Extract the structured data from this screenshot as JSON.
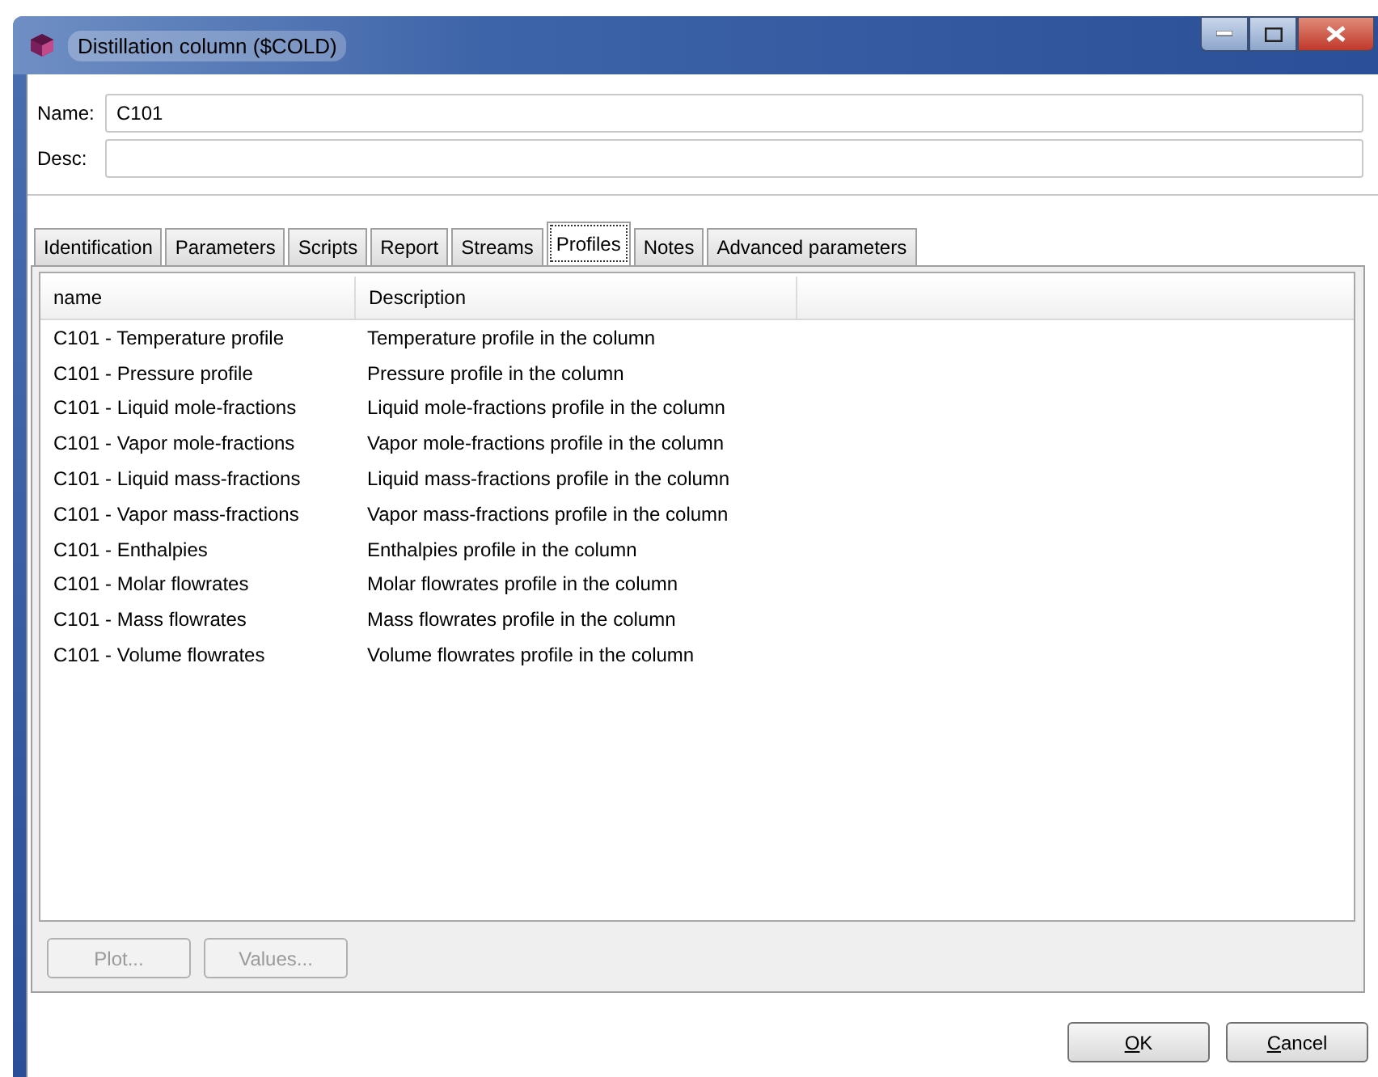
{
  "window": {
    "title": "Distillation column ($COLD)"
  },
  "fields": [
    {
      "label": "Name:",
      "value": "C101"
    },
    {
      "label": "Desc:"
    }
  ],
  "tabs": [
    {
      "label": "Identification",
      "selected": false
    },
    {
      "label": "Parameters",
      "selected": false
    },
    {
      "label": "Scripts",
      "selected": false
    },
    {
      "label": "Report",
      "selected": false
    },
    {
      "label": "Streams",
      "selected": false
    },
    {
      "label": "Profiles",
      "selected": true
    },
    {
      "label": "Notes",
      "selected": false
    },
    {
      "label": "Advanced parameters",
      "selected": false
    }
  ],
  "table": {
    "columns": [
      "name",
      "Description"
    ],
    "rows": [
      [
        "C101 - Temperature profile",
        "Temperature profile in the column"
      ],
      [
        "C101 - Pressure profile",
        "Pressure profile in the column"
      ],
      [
        "C101 - Liquid mole-fractions",
        "Liquid mole-fractions profile in the column"
      ],
      [
        "C101 - Vapor mole-fractions",
        "Vapor mole-fractions profile in the column"
      ],
      [
        "C101 - Liquid mass-fractions",
        "Liquid mass-fractions profile in the column"
      ],
      [
        "C101 - Vapor mass-fractions",
        "Vapor mass-fractions profile in the column"
      ],
      [
        "C101 - Enthalpies",
        "Enthalpies profile in the column"
      ],
      [
        "C101 - Molar flowrates",
        "Molar flowrates profile in the column"
      ],
      [
        "C101 - Mass flowrates",
        "Mass flowrates profile in the column"
      ],
      [
        "C101 - Volume flowrates",
        "Volume flowrates profile in the column"
      ]
    ]
  },
  "panel_buttons": [
    {
      "label": "Plot...",
      "disabled": true
    },
    {
      "label": "Values...",
      "disabled": true
    }
  ],
  "dialog_buttons": [
    {
      "label": "OK",
      "mnemonic_underlined": true
    },
    {
      "label": "Cancel",
      "mnemonic_underlined": true
    }
  ]
}
